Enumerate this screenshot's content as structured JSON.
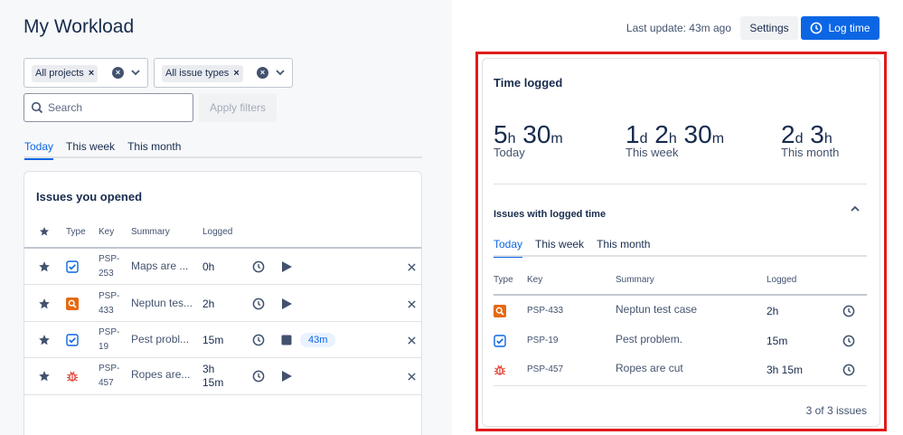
{
  "page": {
    "title": "My Workload"
  },
  "filters": {
    "projects_chip": "All projects",
    "issue_types_chip": "All issue types",
    "search_placeholder": "Search",
    "apply_label": "Apply filters"
  },
  "left_tabs": [
    "Today",
    "This week",
    "This month"
  ],
  "issues_opened": {
    "title": "Issues you opened",
    "headers": {
      "type": "Type",
      "key": "Key",
      "summary": "Summary",
      "logged": "Logged"
    },
    "rows": [
      {
        "type": "task",
        "key_line1": "PSP-",
        "key_line2": "253",
        "summary": "Maps are ...",
        "logged_line1": "0h",
        "logged_line2": "",
        "action": "play",
        "badge": ""
      },
      {
        "type": "test",
        "key_line1": "PSP-",
        "key_line2": "433",
        "summary": "Neptun tes...",
        "logged_line1": "2h",
        "logged_line2": "",
        "action": "play",
        "badge": ""
      },
      {
        "type": "task",
        "key_line1": "PSP-",
        "key_line2": "19",
        "summary": "Pest probl...",
        "logged_line1": "15m",
        "logged_line2": "",
        "action": "stop",
        "badge": "43m"
      },
      {
        "type": "bug",
        "key_line1": "PSP-",
        "key_line2": "457",
        "summary": "Ropes are...",
        "logged_line1": "3h",
        "logged_line2": "15m",
        "action": "play",
        "badge": ""
      }
    ]
  },
  "header": {
    "last_update": "Last update: 43m ago",
    "settings_label": "Settings",
    "log_time_label": "Log time"
  },
  "time_logged": {
    "title": "Time logged",
    "today": {
      "d": "",
      "h": "5",
      "m": "30",
      "label": "Today"
    },
    "week": {
      "d": "1",
      "h": "2",
      "m": "30",
      "label": "This week"
    },
    "month": {
      "d": "2",
      "h": "3",
      "m": "",
      "label": "This month"
    },
    "units": {
      "d": "d",
      "h": "h",
      "m": "m"
    }
  },
  "logged_issues": {
    "title": "Issues with logged time",
    "tabs": [
      "Today",
      "This week",
      "This month"
    ],
    "headers": {
      "type": "Type",
      "key": "Key",
      "summary": "Summary",
      "logged": "Logged"
    },
    "rows": [
      {
        "type": "test",
        "key": "PSP-433",
        "summary": "Neptun test case",
        "logged": "2h"
      },
      {
        "type": "task",
        "key": "PSP-19",
        "summary": "Pest problem.",
        "logged": "15m"
      },
      {
        "type": "bug",
        "key": "PSP-457",
        "summary": "Ropes are cut",
        "logged": "3h 15m"
      }
    ],
    "footer": "3 of 3 issues"
  },
  "colors": {
    "accent": "#0c66e4",
    "highlight": "#e01b1b",
    "test_icon": "#e56910",
    "bug_icon": "#e2483d"
  }
}
